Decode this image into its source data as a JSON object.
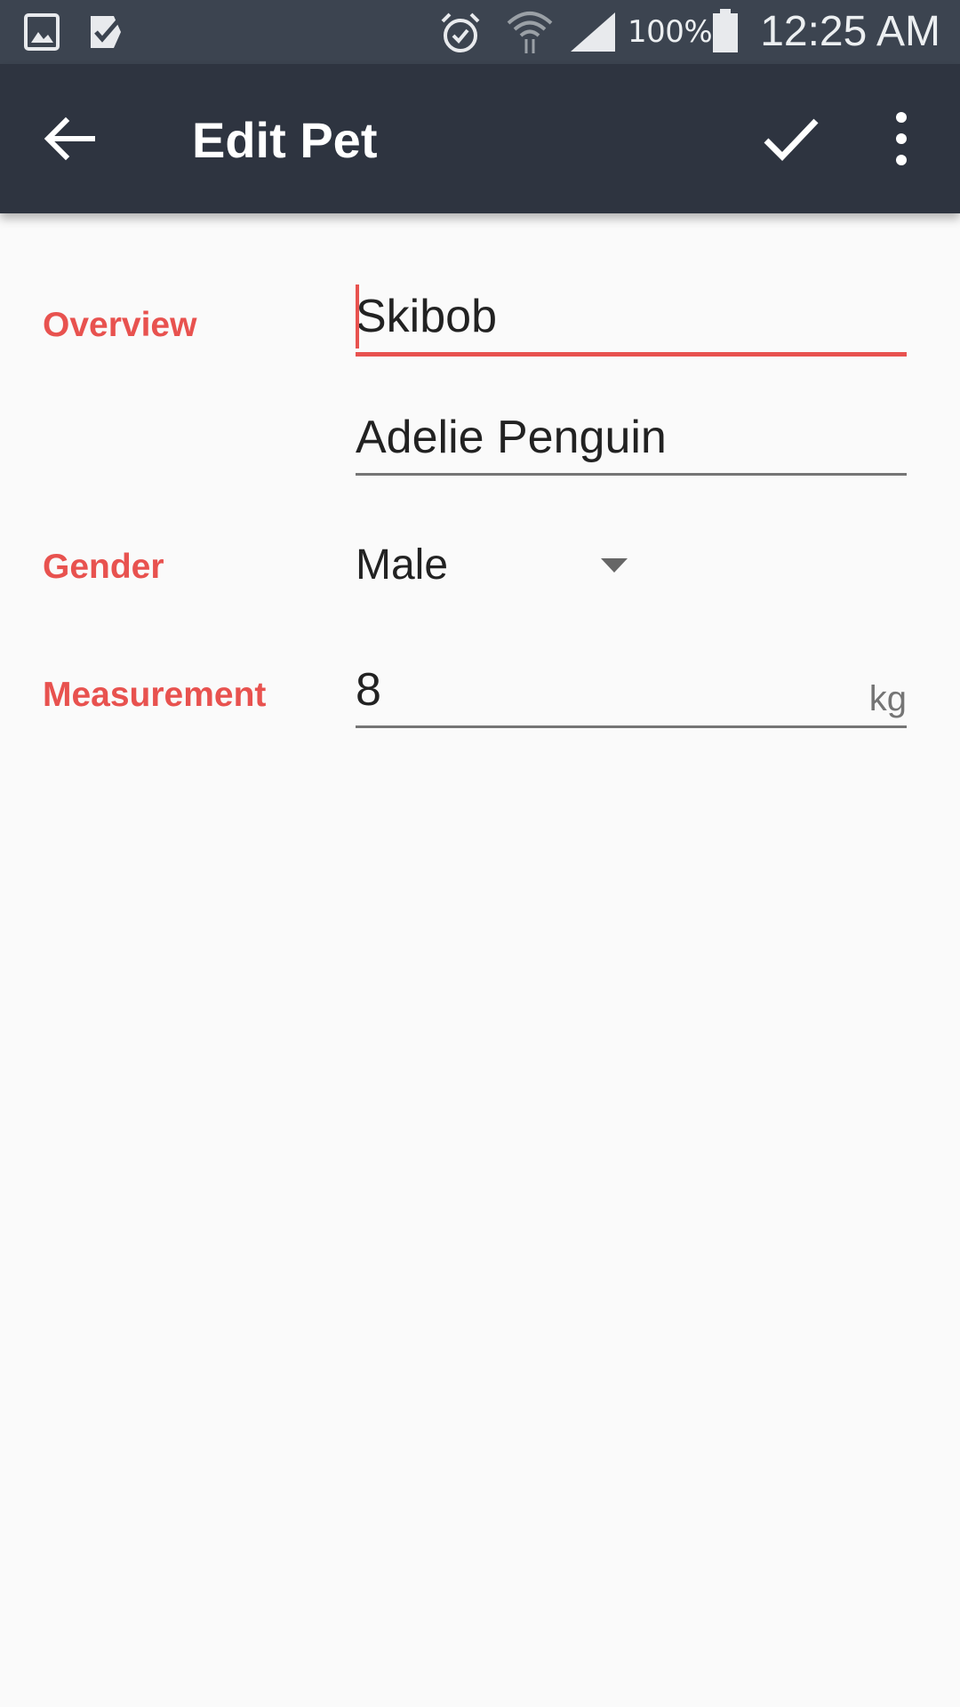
{
  "status_bar": {
    "icons": [
      "gallery-icon",
      "task-check-icon",
      "alarm-icon",
      "wifi-icon",
      "signal-icon",
      "battery-icon"
    ],
    "battery": "100%",
    "time": "12:25 AM"
  },
  "app_bar": {
    "title": "Edit Pet",
    "back_icon": "arrow-back-icon",
    "save_icon": "check-icon",
    "more_icon": "more-vert-icon"
  },
  "form": {
    "overview_label": "Overview",
    "name_value": "Skibob",
    "species_value": "Adelie Penguin",
    "gender_label": "Gender",
    "gender_value": "Male",
    "measurement_label": "Measurement",
    "measurement_value": "8",
    "measurement_unit": "kg"
  },
  "colors": {
    "accent": "#e8524f",
    "app_bar": "#2e3440",
    "status_bar": "#3c4450",
    "background": "#fafafa"
  }
}
